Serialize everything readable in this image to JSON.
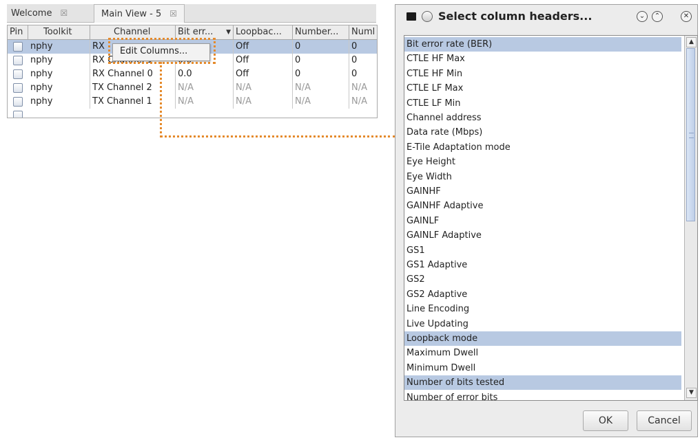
{
  "tabs": [
    {
      "label": "Welcome",
      "close": "☒"
    },
    {
      "label": "Main View - 5",
      "close": "☒"
    }
  ],
  "table": {
    "headers": [
      "Pin",
      "Toolkit",
      "Channel",
      "Bit err...",
      "Loopbac...",
      "Number...",
      "Numl"
    ],
    "rows": [
      {
        "toolkit": "nphy",
        "channel": "RX",
        "ber": "",
        "loopback": "Off",
        "n1": "0",
        "n2": "0",
        "selected": true
      },
      {
        "toolkit": "nphy",
        "channel": "RX Channel 1",
        "ber": "0.0",
        "loopback": "Off",
        "n1": "0",
        "n2": "0"
      },
      {
        "toolkit": "nphy",
        "channel": "RX Channel 0",
        "ber": "0.0",
        "loopback": "Off",
        "n1": "0",
        "n2": "0"
      },
      {
        "toolkit": "nphy",
        "channel": "TX Channel 2",
        "ber": "N/A",
        "loopback": "N/A",
        "n1": "N/A",
        "n2": "N/A"
      },
      {
        "toolkit": "nphy",
        "channel": "TX Channel 1",
        "ber": "N/A",
        "loopback": "N/A",
        "n1": "N/A",
        "n2": "N/A"
      }
    ]
  },
  "context_menu": {
    "item": "Edit Columns..."
  },
  "dialog": {
    "title": "Select column headers...",
    "items": [
      {
        "label": "Bit error rate (BER)",
        "selected": true
      },
      {
        "label": "CTLE HF Max"
      },
      {
        "label": "CTLE HF Min"
      },
      {
        "label": "CTLE LF Max"
      },
      {
        "label": "CTLE LF Min"
      },
      {
        "label": "Channel address"
      },
      {
        "label": "Data rate (Mbps)"
      },
      {
        "label": "E-Tile Adaptation mode"
      },
      {
        "label": "Eye Height"
      },
      {
        "label": "Eye Width"
      },
      {
        "label": "GAINHF"
      },
      {
        "label": "GAINHF Adaptive"
      },
      {
        "label": "GAINLF"
      },
      {
        "label": "GAINLF Adaptive"
      },
      {
        "label": "GS1"
      },
      {
        "label": "GS1 Adaptive"
      },
      {
        "label": "GS2"
      },
      {
        "label": "GS2 Adaptive"
      },
      {
        "label": "Line Encoding"
      },
      {
        "label": "Live Updating"
      },
      {
        "label": "Loopback mode",
        "selected": true
      },
      {
        "label": "Maximum Dwell"
      },
      {
        "label": "Minimum Dwell"
      },
      {
        "label": "Number of bits tested",
        "selected": true
      },
      {
        "label": "Number of error bits"
      }
    ],
    "ok_label": "OK",
    "cancel_label": "Cancel"
  },
  "colors": {
    "selection": "#b8c9e2",
    "callout": "#e58a2b"
  },
  "icons": [
    "window-menu-icon",
    "window-circle-icon",
    "minimize-icon",
    "maximize-icon",
    "close-icon",
    "scroll-up-icon",
    "scroll-down-icon"
  ]
}
